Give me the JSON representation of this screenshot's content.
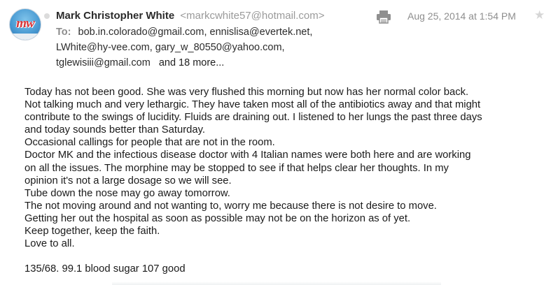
{
  "header": {
    "sender_name": "Mark Christopher White",
    "sender_email": "<markcwhite57@hotmail.com>",
    "avatar_initials": "mw",
    "date": "Aug 25, 2014 at 1:54 PM",
    "to_label": "To:",
    "recipients_line1": "bob.in.colorado@gmail.com,   ennislisa@evertek.net,",
    "recipients_line2": "LWhite@hy-vee.com,   gary_w_80550@yahoo.com,",
    "recipients_line3": "tglewisiii@gmail.com",
    "more_recipients": "and 18 more..."
  },
  "icons": {
    "print": "print-icon",
    "star": "star-icon",
    "unread": "unread-dot"
  },
  "body": {
    "lines": [
      "Today has not been good. She was very flushed this morning but now has her normal color back.",
      "Not talking much and very lethargic. They have taken most all of the antibiotics away and that might",
      "contribute to the swings of lucidity. Fluids are draining out. I listened to her lungs the past three days",
      "and today sounds better than Saturday.",
      "Occasional callings for people that are not in the room.",
      "Doctor MK and the infectious disease doctor with 4 Italian names were both here and are working",
      "on all the issues. The morphine may be stopped to see if that helps clear her thoughts. In my",
      "opinion it's not a large dosage so we will see.",
      "Tube down the nose may go away tomorrow.",
      "The not moving around and not wanting to, worry me because there is not desire to move.",
      "Getting her out the hospital as soon as possible may not be on the horizon as of yet.",
      "Keep together, keep the faith.",
      "Love to all."
    ],
    "vitals": "135/68. 99.1 blood sugar 107 good"
  }
}
